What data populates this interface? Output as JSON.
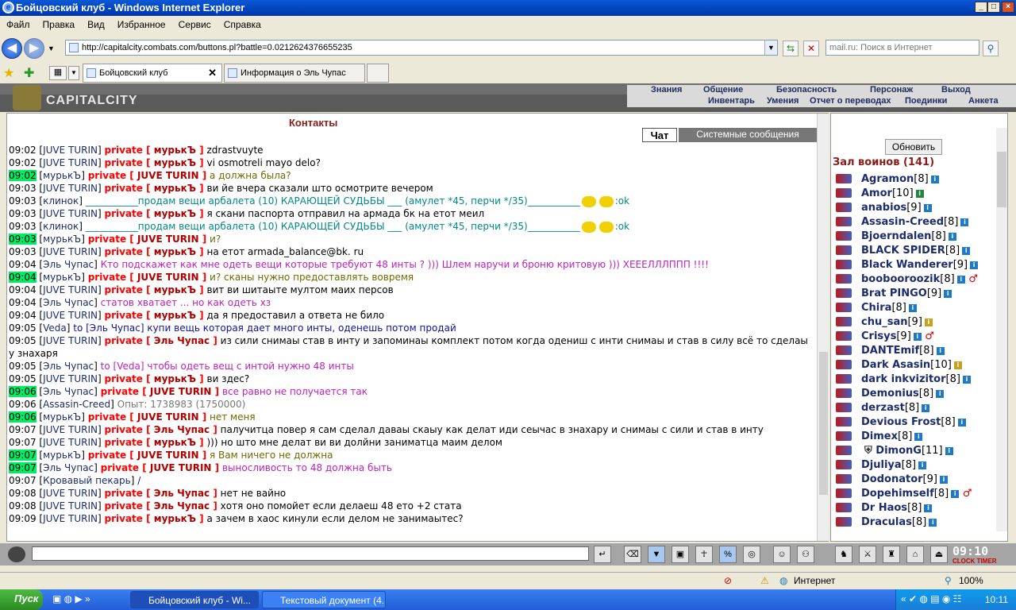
{
  "window": {
    "title": "Бойцовский клуб - Windows Internet Explorer"
  },
  "menu": [
    "Файл",
    "Правка",
    "Вид",
    "Избранное",
    "Сервис",
    "Справка"
  ],
  "address": {
    "url": "http://capitalcity.combats.com/buttons.pl?battle=0.0212624376655235"
  },
  "search": {
    "placeholder": "mail.ru: Поиск в Интернет"
  },
  "tabs": [
    {
      "label": "Бойцовский клуб"
    },
    {
      "label": "Информация о Эль Чупас"
    }
  ],
  "site": {
    "logo_text": "CAPITALCITY",
    "top_nav": [
      "Знания",
      "Общение",
      "Безопасность",
      "Персонаж",
      "Выход"
    ],
    "sub_nav": [
      "Инвентарь",
      "Умения",
      "Отчет о переводах",
      "Поединки",
      "Анкета"
    ]
  },
  "content": {
    "contacts_title": "Контакты"
  },
  "chat_tabs": {
    "chat": "Чат",
    "system": "Системные сообщения"
  },
  "chat": [
    {
      "time": "09:02",
      "hl": false,
      "nick": "JUVE TURIN",
      "priv": "мурькЪ",
      "msg": "zdrastvuyte",
      "cls": "msg"
    },
    {
      "time": "09:02",
      "hl": false,
      "nick": "JUVE TURIN",
      "priv": "мурькЪ",
      "msg": "vi osmotreli mayo delo?",
      "cls": "msg"
    },
    {
      "time": "09:02",
      "hl": true,
      "nick": "мурькЪ",
      "priv": "JUVE TURIN",
      "msg": "а должна была?",
      "cls": "olive"
    },
    {
      "time": "09:03",
      "hl": false,
      "nick": "JUVE TURIN",
      "priv": "мурькЪ",
      "msg": "ви йе вчера сказали што осмотрите вечером",
      "cls": "msg"
    },
    {
      "time": "09:03",
      "hl": false,
      "nick": "клинок",
      "priv": "",
      "msg": "___________продам вещи арбалета (10) КАРАЮЩЕЙ СУДЬБЫ ___ (амулет *45, перчи */35)___________",
      "cls": "teal",
      "tail": ":ok",
      "smiles": 2
    },
    {
      "time": "09:03",
      "hl": false,
      "nick": "JUVE TURIN",
      "priv": "мурькЪ",
      "msg": "я скани паспорта отправил на армада бк на етот меил",
      "cls": "msg"
    },
    {
      "time": "09:03",
      "hl": false,
      "nick": "клинок",
      "priv": "",
      "msg": "___________продам вещи арбалета (10) КАРАЮЩЕЙ СУДЬБЫ ___ (амулет *45, перчи */35)___________",
      "cls": "teal",
      "tail": ":ok",
      "smiles": 2
    },
    {
      "time": "09:03",
      "hl": true,
      "nick": "мурькЪ",
      "priv": "JUVE TURIN",
      "msg": "и?",
      "cls": "olive"
    },
    {
      "time": "09:03",
      "hl": false,
      "nick": "JUVE TURIN",
      "priv": "мурькЪ",
      "msg": "на етот armada_balance@bk. ru",
      "cls": "msg"
    },
    {
      "time": "09:04",
      "hl": false,
      "nick": "Эль Чупас",
      "priv": "",
      "msg": "Кто подскажет как мне одеть вещи которые требуют 48 инты ? ))) Шлем наручи и броню критовую ))) ХЕЕЕЛЛЛППП !!!!",
      "cls": "ppl"
    },
    {
      "time": "09:04",
      "hl": true,
      "nick": "мурькЪ",
      "priv": "JUVE TURIN",
      "msg": "и? сканы нужно предоставлять вовремя",
      "cls": "olive"
    },
    {
      "time": "09:04",
      "hl": false,
      "nick": "JUVE TURIN",
      "priv": "мурькЪ",
      "msg": "вит ви шитаыте мултом маих персов",
      "cls": "msg"
    },
    {
      "time": "09:04",
      "hl": false,
      "nick": "Эль Чупас",
      "priv": "",
      "msg": "статов хватает ... но как одеть хз",
      "cls": "ppl"
    },
    {
      "time": "09:04",
      "hl": false,
      "nick": "JUVE TURIN",
      "priv": "мурькЪ",
      "msg": "да я предоставил а ответа не било",
      "cls": "msg"
    },
    {
      "time": "09:05",
      "hl": false,
      "nick": "Veda",
      "priv": "",
      "msg": "to [Эль Чупас] купи вещь которая дает много инты, оденешь потом продай",
      "cls": "blue"
    },
    {
      "time": "09:05",
      "hl": false,
      "nick": "JUVE TURIN",
      "priv": "Эль Чупас",
      "msg": "из сили снимаы став в инту и запоминаы комплект потом когда одениш с инти снимаы и став в силу всё то сделаы у знахаря",
      "cls": "msg",
      "wrap": true
    },
    {
      "time": "09:05",
      "hl": false,
      "nick": "Эль Чупас",
      "priv": "",
      "msg": "to [Veda] чтобы одеть вещ с интой нужно 48 инты",
      "cls": "ppl"
    },
    {
      "time": "09:05",
      "hl": false,
      "nick": "JUVE TURIN",
      "priv": "мурькЪ",
      "msg": "ви здес?",
      "cls": "msg"
    },
    {
      "time": "09:06",
      "hl": true,
      "nick": "Эль Чупас",
      "priv": "JUVE TURIN",
      "msg": "все равно не получается так",
      "cls": "ppl"
    },
    {
      "time": "09:06",
      "hl": false,
      "nick": "Assasin-Creed",
      "priv": "",
      "msg": "Опыт: 1738983 (1750000)",
      "cls": "gray"
    },
    {
      "time": "09:06",
      "hl": true,
      "nick": "мурькЪ",
      "priv": "JUVE TURIN",
      "msg": "нет меня",
      "cls": "olive"
    },
    {
      "time": "09:07",
      "hl": false,
      "nick": "JUVE TURIN",
      "priv": "Эль Чупас",
      "msg": "палучитца повер я сам сделал даваы скаыу как делат иди сеычас в знахару и снимаы с сили и став в инту",
      "cls": "msg",
      "wrap": true
    },
    {
      "time": "09:07",
      "hl": false,
      "nick": "JUVE TURIN",
      "priv": "мурькЪ",
      "msg": "))) но што мне делат ви ви долйни заниматца маим делом",
      "cls": "msg"
    },
    {
      "time": "09:07",
      "hl": true,
      "nick": "мурькЪ",
      "priv": "JUVE TURIN",
      "msg": "я Вам ничего не должна",
      "cls": "olive"
    },
    {
      "time": "09:07",
      "hl": true,
      "nick": "Эль Чупас",
      "priv": "JUVE TURIN",
      "msg": "выносливость то 48 должна быть",
      "cls": "ppl"
    },
    {
      "time": "09:07",
      "hl": false,
      "nick": "Кровавый пекарь",
      "priv": "",
      "msg": "/",
      "cls": "blue"
    },
    {
      "time": "09:08",
      "hl": false,
      "nick": "JUVE TURIN",
      "priv": "Эль Чупас",
      "msg": "нет не вайно",
      "cls": "msg"
    },
    {
      "time": "09:08",
      "hl": false,
      "nick": "JUVE TURIN",
      "priv": "Эль Чупас",
      "msg": "хотя оно помойет если делаеш 48 ето +2 стата",
      "cls": "msg"
    },
    {
      "time": "09:09",
      "hl": false,
      "nick": "JUVE TURIN",
      "priv": "мурькЪ",
      "msg": "а зачем в хаос кинули если делом не занимаытес?",
      "cls": "msg"
    }
  ],
  "right": {
    "refresh_label": "Обновить",
    "hall_title": "Зал воинов (141)",
    "warriors": [
      {
        "name": "Agramon",
        "level": "[8]",
        "inf": "b"
      },
      {
        "name": "Amor",
        "level": "[10]",
        "inf": "g"
      },
      {
        "name": "anabios",
        "level": "[9]",
        "inf": "b"
      },
      {
        "name": "Assasin-Creed",
        "level": "[8]",
        "inf": "b"
      },
      {
        "name": "Bjoerndalen",
        "level": "[8]",
        "inf": "b"
      },
      {
        "name": "BLACK SPIDER",
        "level": "[8]",
        "inf": "b"
      },
      {
        "name": "Black Wanderer",
        "level": "[9]",
        "inf": "b"
      },
      {
        "name": "boobooroozik",
        "level": "[8]",
        "inf": "b",
        "battle": true
      },
      {
        "name": "Brat PINGO",
        "level": "[9]",
        "inf": "b"
      },
      {
        "name": "Chira",
        "level": "[8]",
        "inf": "b"
      },
      {
        "name": "chu_san",
        "level": "[9]",
        "inf": "y"
      },
      {
        "name": "Crisys",
        "level": "[9]",
        "inf": "b",
        "battle": true
      },
      {
        "name": "DANTEmif",
        "level": "[8]",
        "inf": "b"
      },
      {
        "name": "Dark Asasin",
        "level": "[10]",
        "inf": "y"
      },
      {
        "name": "dark inkvizitor",
        "level": "[8]",
        "inf": "b"
      },
      {
        "name": "Demonius",
        "level": "[8]",
        "inf": "b"
      },
      {
        "name": "derzast",
        "level": "[8]",
        "inf": "b"
      },
      {
        "name": "Devious Frost",
        "level": "[8]",
        "inf": "b"
      },
      {
        "name": "Dimex",
        "level": "[8]",
        "inf": "b"
      },
      {
        "name": "DimonG",
        "level": "[11]",
        "inf": "b",
        "shield": true
      },
      {
        "name": "Djuliya",
        "level": "[8]",
        "inf": "b"
      },
      {
        "name": "Dodonator",
        "level": "[9]",
        "inf": "b"
      },
      {
        "name": "Dopehimself",
        "level": "[8]",
        "inf": "b",
        "battle": true
      },
      {
        "name": "Dr Haos",
        "level": "[8]",
        "inf": "b"
      },
      {
        "name": "Draculas",
        "level": "[8]",
        "inf": "b"
      }
    ]
  },
  "bottom": {
    "clock": "09:10",
    "clock_sub": "CLOCK TIMER"
  },
  "status": {
    "zone": "Интернет",
    "zoom": "100%"
  },
  "taskbar": {
    "start": "Пуск",
    "tasks": [
      "Бойцовский клуб - Wi...",
      "Текстовый документ (4..."
    ],
    "time": "10:11"
  }
}
